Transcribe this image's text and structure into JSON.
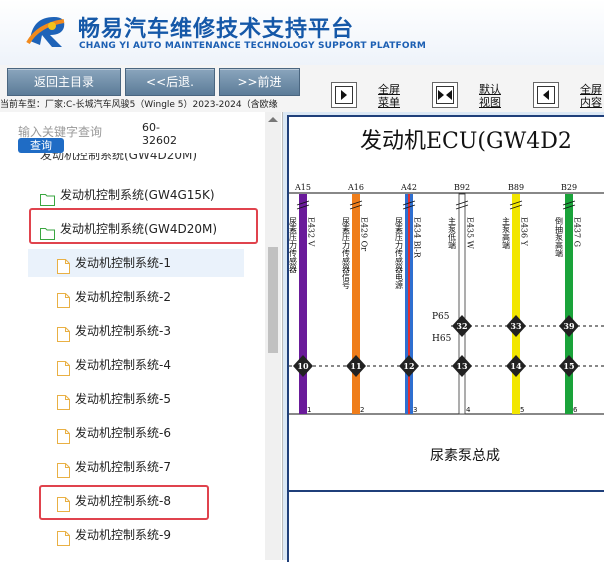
{
  "header": {
    "title": "畅易汽车维修技术支持平台",
    "subtitle": "CHANG YI AUTO MAINTENANCE TECHNOLOGY SUPPORT PLATFORM"
  },
  "toolbar": {
    "home_label": "返回主目录",
    "back_label": "<<后退.",
    "forward_label": ">>前进",
    "fullscreen_menu_label": "全屏菜单",
    "default_view_label": "默认视图",
    "fullscreen_content_label": "全屏内容",
    "car_info": "当前车型：厂家:C-长城汽车风骏5（Wingle 5）2023-2024（含欧缘"
  },
  "search": {
    "placeholder": "输入关键字查询",
    "code": "60-32602",
    "button_label": "查询"
  },
  "tree": {
    "cut_item": "发动机控制系统(GW4D20M)",
    "folders": [
      "发动机控制系统(GW4G15K)",
      "发动机控制系统(GW4D20M)"
    ],
    "docs": [
      "发动机控制系统-1",
      "发动机控制系统-2",
      "发动机控制系统-3",
      "发动机控制系统-4",
      "发动机控制系统-5",
      "发动机控制系统-6",
      "发动机控制系统-7",
      "发动机控制系统-8",
      "发动机控制系统-9"
    ]
  },
  "diagram": {
    "title": "发动机ECU(GW4D2",
    "pins": [
      {
        "pin": "A15",
        "wire": "E432 V",
        "label": "尿素压力传感器",
        "num": "10",
        "conn": "1",
        "color": "#6a1b9a",
        "stripe": null
      },
      {
        "pin": "A16",
        "wire": "E429 Or",
        "label": "尿素压力传感器信号",
        "num": "11",
        "conn": "2",
        "color": "#ef7d1a",
        "stripe": null
      },
      {
        "pin": "A42",
        "wire": "E434 Bl-R",
        "label": "尿素压力传感器电源",
        "num": "12",
        "conn": "3",
        "color": "#2f6fd0",
        "stripe": "#e03030"
      },
      {
        "pin": "B92",
        "wire": "E435 W",
        "label": "主泵低端",
        "num": "13",
        "conn": "4",
        "color": "#ffffff",
        "stripe": null
      },
      {
        "pin": "B89",
        "wire": "E436 Y",
        "label": "主泵高端",
        "num": "14",
        "conn": "5",
        "color": "#f2e600",
        "stripe": null
      },
      {
        "pin": "B29",
        "wire": "E437 G",
        "label": "倒抽泵高端",
        "num": "15",
        "conn": "6",
        "color": "#1aa33a",
        "stripe": null
      }
    ],
    "upper_nodes": [
      "32",
      "33",
      "39"
    ],
    "connector_labels": [
      "P65",
      "H65"
    ],
    "component": "尿素泵总成"
  },
  "colors": {
    "brand": "#1558a8",
    "highlight": "#e0434d",
    "query_button": "#1f6cc5",
    "selected_item": "#eaf2fb"
  },
  "icons": {
    "folder": "folder-icon",
    "document": "document-icon"
  }
}
